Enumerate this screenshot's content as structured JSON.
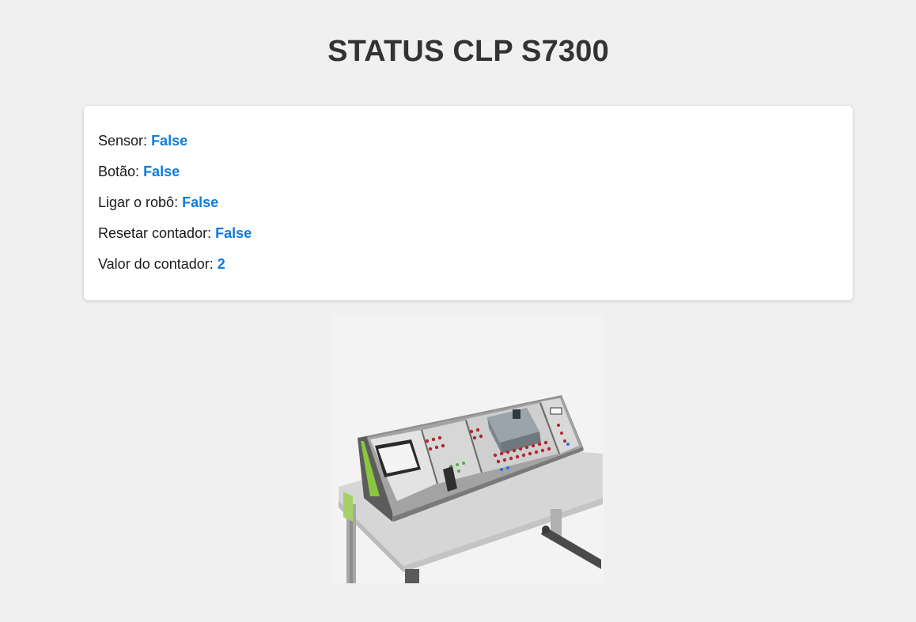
{
  "header": {
    "title": "STATUS CLP S7300"
  },
  "status": {
    "items": [
      {
        "label": "Sensor:",
        "value": "False"
      },
      {
        "label": "Botão:",
        "value": "False"
      },
      {
        "label": "Ligar o robô:",
        "value": "False"
      },
      {
        "label": "Resetar contador:",
        "value": "False"
      },
      {
        "label": "Valor do contador:",
        "value": "2"
      }
    ]
  },
  "image": {
    "subject": "plc-training-workbench",
    "colors": {
      "accent_text": "#0f7bdc",
      "panel": "#9a9a9a",
      "trim": "#8cc63f",
      "table": "#d9d9d9"
    }
  }
}
